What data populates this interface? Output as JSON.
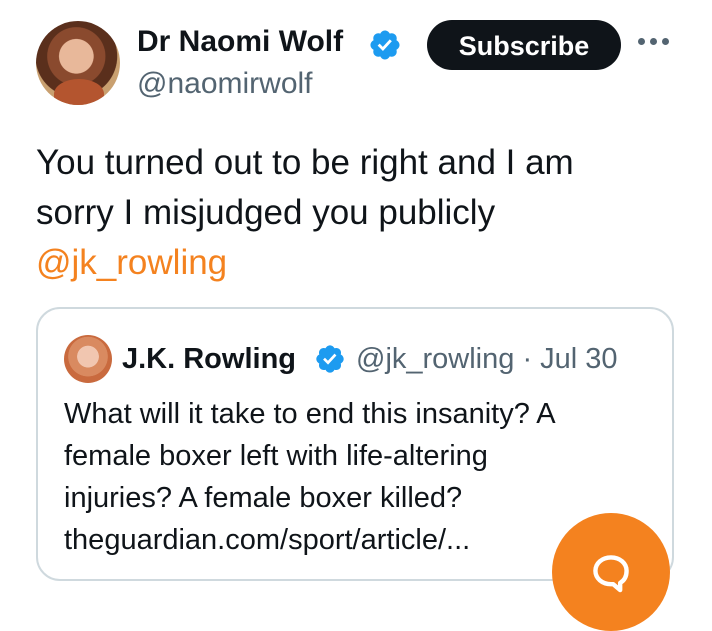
{
  "tweet": {
    "author": {
      "name": "Dr Naomi Wolf",
      "handle": "@naomirwolf",
      "avatar_icon": "profile-photo",
      "verified_icon": "verified-badge-icon"
    },
    "subscribe_label": "Subscribe",
    "more_icon": "more-options-icon",
    "text_lines": [
      "You turned out to be right and I am",
      "sorry I misjudged you publicly"
    ],
    "mention": "@jk_rowling"
  },
  "quoted_tweet": {
    "author": {
      "name": "J.K. Rowling",
      "handle": "@jk_rowling",
      "date": "Jul 30",
      "meta": "@jk_rowling · Jul 30",
      "verified_icon": "verified-badge-icon"
    },
    "text_lines": [
      "What will it take to end this insanity? A",
      "female boxer left with life-altering",
      "injuries? A female boxer killed?",
      "theguardian.com/sport/article/..."
    ]
  },
  "fab": {
    "icon": "reply-chat-icon"
  },
  "colors": {
    "accent": "#f4821f",
    "verified": "#1d9bf0",
    "text": "#0f1419",
    "secondary_text": "#536471",
    "border": "#cfd9de"
  }
}
